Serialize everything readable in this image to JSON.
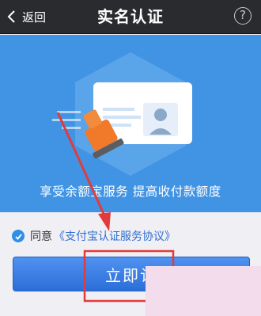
{
  "header": {
    "back_label": "返回",
    "title": "实名认证",
    "help_glyph": "?"
  },
  "banner": {
    "text": "享受余额宝服务 提高收付款额度"
  },
  "agreement": {
    "checked": true,
    "prefix": "同意",
    "link": "《支付宝认证服务协议》"
  },
  "primary_button": {
    "label": "立即认"
  },
  "colors": {
    "header_bg": "#2a2b2e",
    "banner_bg": "#4194e4",
    "accent_blue": "#2f8fe6",
    "annotation_red": "#e23b3b",
    "mask_pink": "#f3dcec"
  },
  "icons": [
    "back-chevron-icon",
    "help-icon",
    "id-card-illustration",
    "stamp-icon",
    "check-icon",
    "annotation-arrow"
  ]
}
